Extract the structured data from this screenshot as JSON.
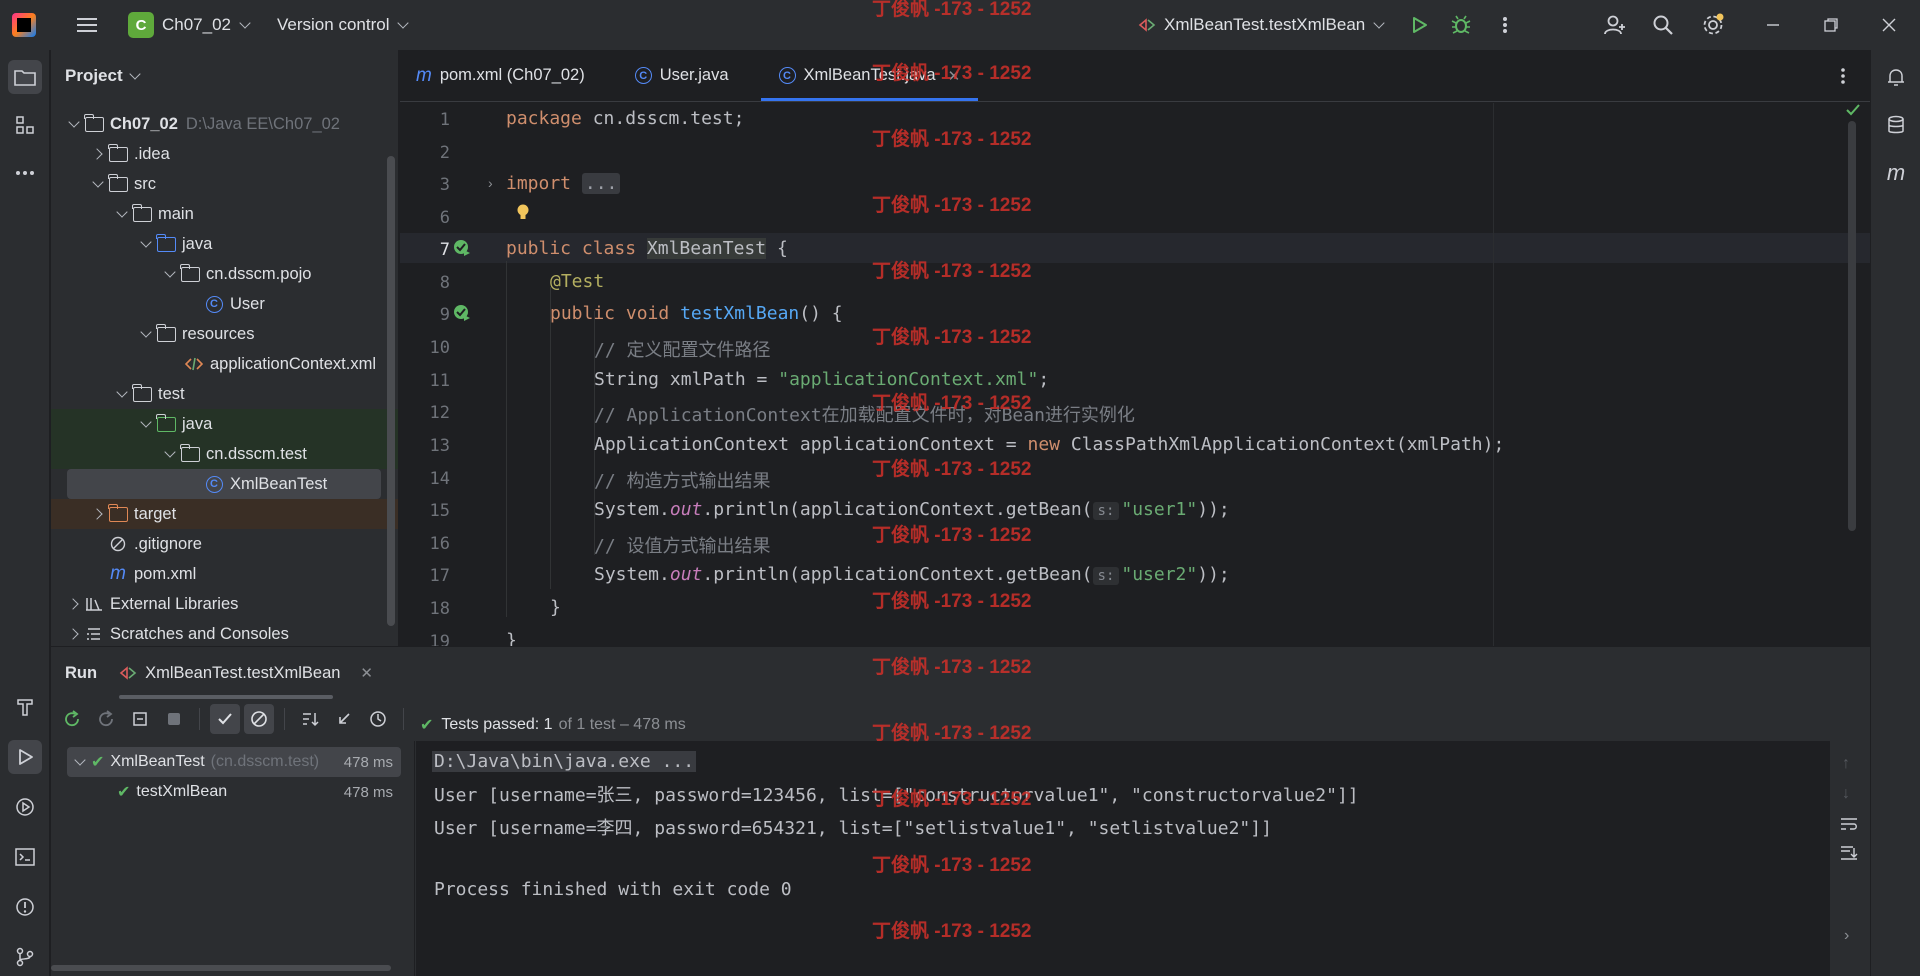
{
  "titlebar": {
    "project_badge": "C",
    "project_name": "Ch07_02",
    "vcs_label": "Version control",
    "run_config": "XmlBeanTest.testXmlBean"
  },
  "project_panel": {
    "title": "Project",
    "tree": [
      {
        "label": "Ch07_02",
        "path": "D:\\Java EE\\Ch07_02"
      },
      {
        "label": ".idea"
      },
      {
        "label": "src"
      },
      {
        "label": "main"
      },
      {
        "label": "java"
      },
      {
        "label": "cn.dsscm.pojo"
      },
      {
        "label": "User"
      },
      {
        "label": "resources"
      },
      {
        "label": "applicationContext.xml"
      },
      {
        "label": "test"
      },
      {
        "label": "java"
      },
      {
        "label": "cn.dsscm.test"
      },
      {
        "label": "XmlBeanTest"
      },
      {
        "label": "target"
      },
      {
        "label": ".gitignore"
      },
      {
        "label": "pom.xml"
      },
      {
        "label": "External Libraries"
      },
      {
        "label": "Scratches and Consoles"
      }
    ]
  },
  "tabs": [
    {
      "label": "pom.xml (Ch07_02)",
      "icon": "maven-icon"
    },
    {
      "label": "User.java",
      "icon": "class-icon"
    },
    {
      "label": "XmlBeanTest.java",
      "icon": "class-icon"
    }
  ],
  "editor": {
    "line_numbers": [
      "1",
      "2",
      "3",
      "6",
      "7",
      "8",
      "9",
      "10",
      "11",
      "12",
      "13",
      "14",
      "15",
      "16",
      "17",
      "18",
      "19"
    ],
    "code": {
      "l1_kw": "package",
      "l1_rest": " cn.dsscm.test;",
      "l3_kw": "import",
      "l3_fold": "...",
      "l7_kw": "public class",
      "l7_cls": "XmlBeanTest",
      "l7_rest": " {",
      "l8_ann": "@Test",
      "l9_kw": "public void",
      "l9_fn": "testXmlBean",
      "l9_rest": "() {",
      "l10_cmt": "// 定义配置文件路径",
      "l11_a": "String xmlPath = ",
      "l11_str": "\"applicationContext.xml\"",
      "l11_b": ";",
      "l12_cmt": "// ApplicationContext在加载配置文件时，对Bean进行实例化",
      "l13_a": "ApplicationContext applicationContext = ",
      "l13_kw": "new",
      "l13_b": " ClassPathXmlApplicationContext(xmlPath);",
      "l14_cmt": "// 构造方式输出结果",
      "l15_a": "System.",
      "l15_it": "out",
      "l15_b": ".println(applicationContext.getBean(",
      "l15_hint": "s:",
      "l15_str": "\"user1\"",
      "l15_c": "));",
      "l16_cmt": "// 设值方式输出结果",
      "l17_a": "System.",
      "l17_it": "out",
      "l17_b": ".println(applicationContext.getBean(",
      "l17_hint": "s:",
      "l17_str": "\"user2\"",
      "l17_c": "));",
      "l18": "}",
      "l19": "}"
    }
  },
  "run_panel": {
    "title": "Run",
    "tab": "XmlBeanTest.testXmlBean",
    "tests": [
      {
        "name": "XmlBeanTest",
        "pkg": "(cn.dsscm.test)",
        "time": "478 ms"
      },
      {
        "name": "testXmlBean",
        "time": "478 ms"
      }
    ],
    "status_bold": "Tests passed: 1",
    "status_rest": "of 1 test – 478 ms",
    "console": [
      "D:\\Java\\bin\\java.exe ...",
      "User [username=张三, password=123456, list=[\"constructorvalue1\", \"constructorvalue2\"]]",
      "User [username=李四, password=654321, list=[\"setlistvalue1\", \"setlistvalue2\"]]",
      "",
      "Process finished with exit code 0"
    ]
  },
  "watermark": "丁俊帆 -173 - 1252",
  "colors": {
    "accent": "#3574f0",
    "pass": "#5fb865",
    "watermark": "#d0302a"
  }
}
